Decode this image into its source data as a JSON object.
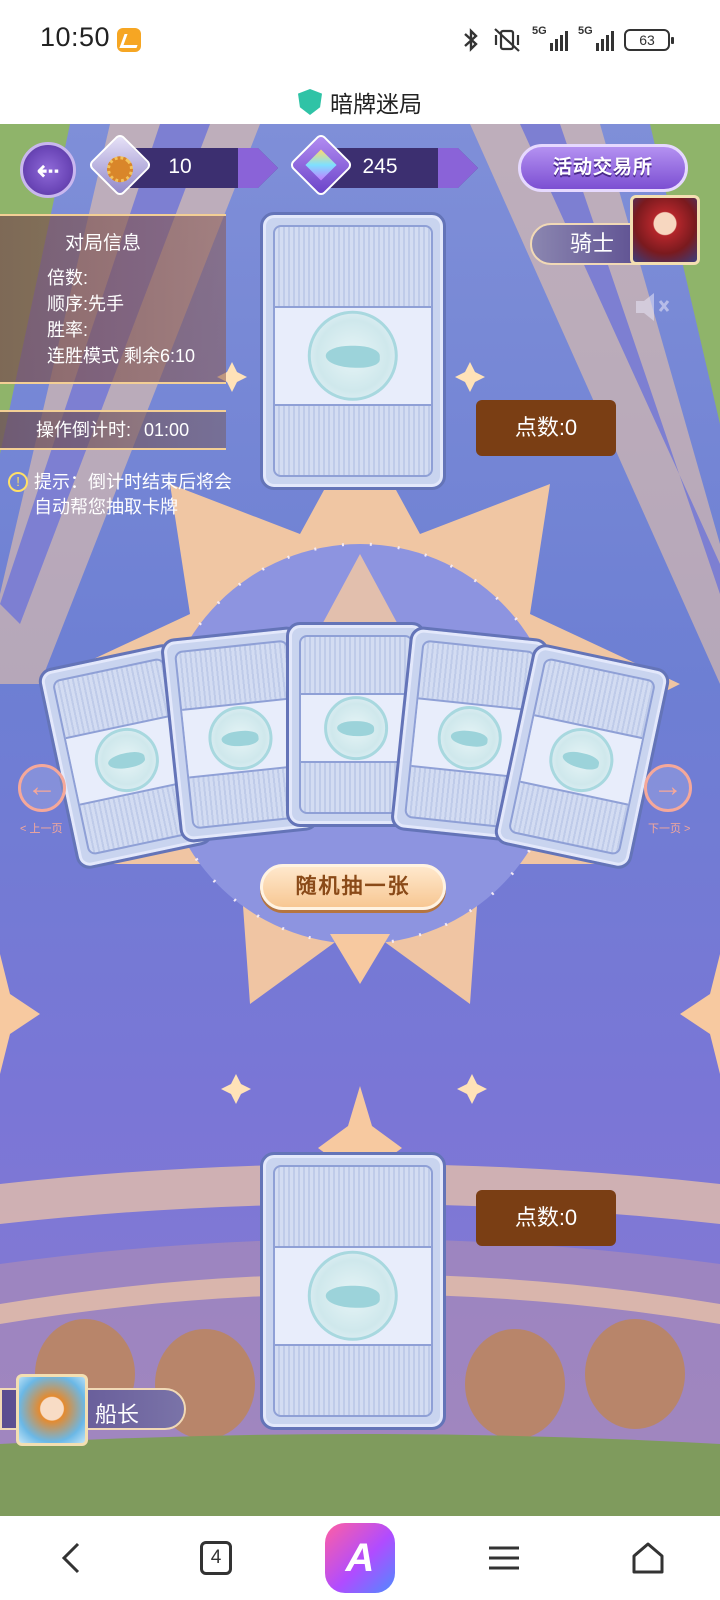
{
  "status_bar": {
    "time": "10:50",
    "battery": "63",
    "signal_1": "5G",
    "signal_2": "5G",
    "icons": [
      "app-badge-icon",
      "bluetooth-icon",
      "vibrate-off-icon",
      "signal-icon",
      "signal-icon",
      "battery-icon"
    ]
  },
  "title_bar": {
    "title": "暗牌迷局",
    "icon": "shield-icon"
  },
  "hud": {
    "coin_value": "10",
    "gem_value": "245",
    "exchange_label": "活动交易所",
    "back_icon": "back-gear-icon"
  },
  "info_panel": {
    "title": "对局信息",
    "multiplier": "倍数:",
    "order": "顺序:先手",
    "win_rate": "胜率:",
    "mode": "连胜模式 剩余6:10"
  },
  "countdown": {
    "label": "操作倒计时:",
    "value": "01:00"
  },
  "hint": {
    "text": "提示：倒计时结束后将会自动帮您抽取卡牌"
  },
  "opponent": {
    "name": "骑士",
    "points": "点数:0"
  },
  "player": {
    "name": "船长",
    "points": "点数:0"
  },
  "hand": {
    "prev_label": "< 上一页",
    "next_label": "下一页 >",
    "draw_button": "随机抽一张"
  },
  "bottom_nav": {
    "tabs_count": "4",
    "ai_label": "A"
  },
  "colors": {
    "accent": "#8a63d8",
    "points_box": "#7a3e14",
    "board": "#7a80d6",
    "sun": "#f7c9a0"
  }
}
